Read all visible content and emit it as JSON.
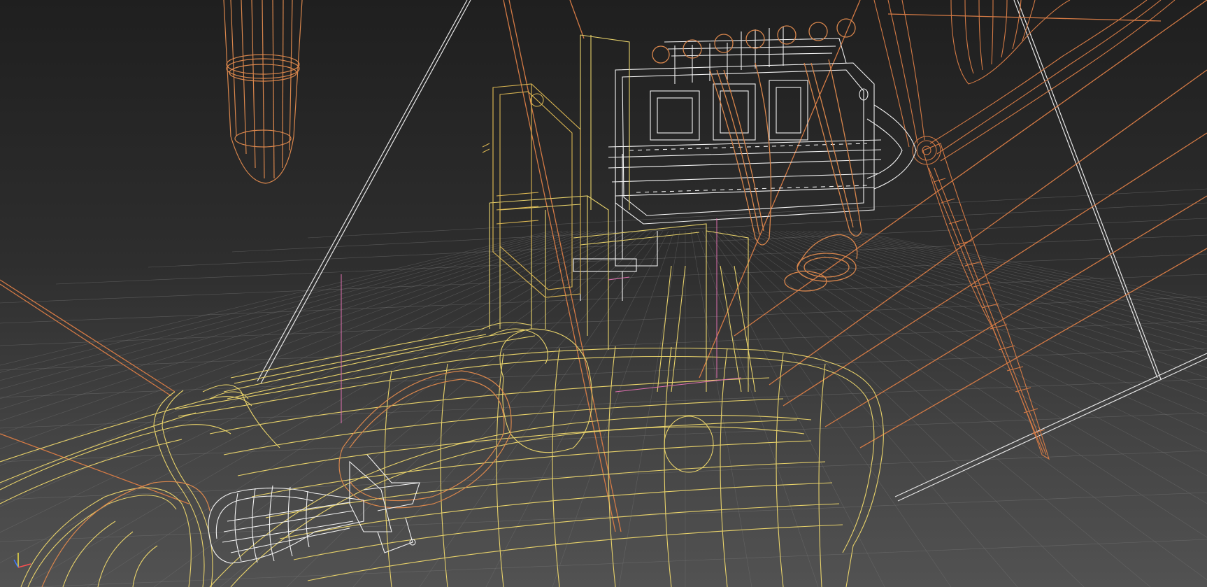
{
  "viewport": {
    "view": "perspective",
    "shading": "wireframe",
    "grid": true,
    "background_gradient": [
      "#1f1f1f",
      "#525252"
    ]
  },
  "colors": {
    "grid_line": "#7a7a7a",
    "frame_yellow": "#e8d26a",
    "frame_gold": "#d9b552",
    "hull_orange": "#d9864c",
    "propeller_orange": "#d47a45",
    "engine_white": "#f2f2f2",
    "rigging_white": "#e6e6e6",
    "gizmo_x": "#ff5050",
    "gizmo_y": "#3c78ff",
    "gizmo_z": "#f0e046",
    "pivot_pink": "#e070b0"
  },
  "objects": [
    {
      "name": "engine",
      "shading": "wireframe",
      "color_key": "engine_white"
    },
    {
      "name": "propeller",
      "shading": "wireframe",
      "color_key": "propeller_orange"
    },
    {
      "name": "fuselage",
      "shading": "wireframe",
      "color_key": "frame_yellow"
    },
    {
      "name": "bomb",
      "shading": "wireframe",
      "color_key": "engine_white"
    },
    {
      "name": "fuel-tank",
      "shading": "wireframe",
      "color_key": "hull_orange"
    },
    {
      "name": "radiator",
      "shading": "wireframe",
      "color_key": "frame_gold"
    }
  ]
}
